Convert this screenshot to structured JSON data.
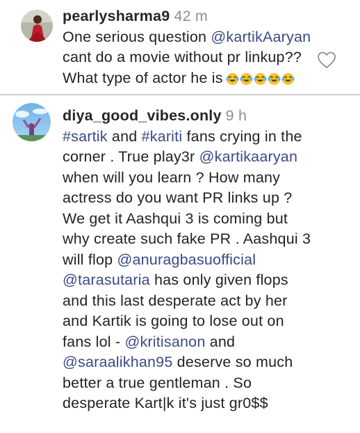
{
  "comments": [
    {
      "username": "pearlysharma9",
      "time": "42 m",
      "lines": {
        "l1_pre": "One serious question ",
        "l1_mention": "@kartikAaryan",
        "l2": "cant do a movie without pr linkup??",
        "l3": "What type of actor he is"
      },
      "emoji_icon": "laughing-crying-emoji-icon",
      "emoji_count": 5,
      "avatar_icon": "profile-photo-red-dress"
    },
    {
      "username": "diya_good_vibes.only",
      "time": "9 h",
      "lines": {
        "l1_tag1": "#sartik",
        "l1_mid": " and ",
        "l1_tag2": "#kariti",
        "l1_post": " fans crying in the",
        "l2_pre": "corner . True play3r ",
        "l2_mention": "@kartikaaryan",
        "l3": "when will you learn ? How many",
        "l4": "actress do you want PR links up ?",
        "l5": "We get it Aashqui 3 is coming but",
        "l6": "why create such fake PR . Aashqui 3",
        "l7_pre": "will flop ",
        "l7_mention": "@anuragbasuofficial",
        "l8_mention": "@tarasutaria",
        "l8_post": " has only given flops",
        "l9": "and this last desperate act by her",
        "l10": "and Kartik is going to lose out on",
        "l11_pre": "fans lol - ",
        "l11_mention": "@kritisanon",
        "l11_post": " and",
        "l12_mention": "@saraalikhan95",
        "l12_post": " deserve so much",
        "l13": "better a true gentleman . So",
        "l14": "desperate Kart|k it's just gr0$$"
      },
      "avatar_icon": "profile-photo-sky-figure"
    }
  ],
  "colors": {
    "mention": "#3a4a86",
    "username": "#262626",
    "time": "#8e8e8e"
  },
  "icons": {
    "like": "heart-outline-icon"
  }
}
